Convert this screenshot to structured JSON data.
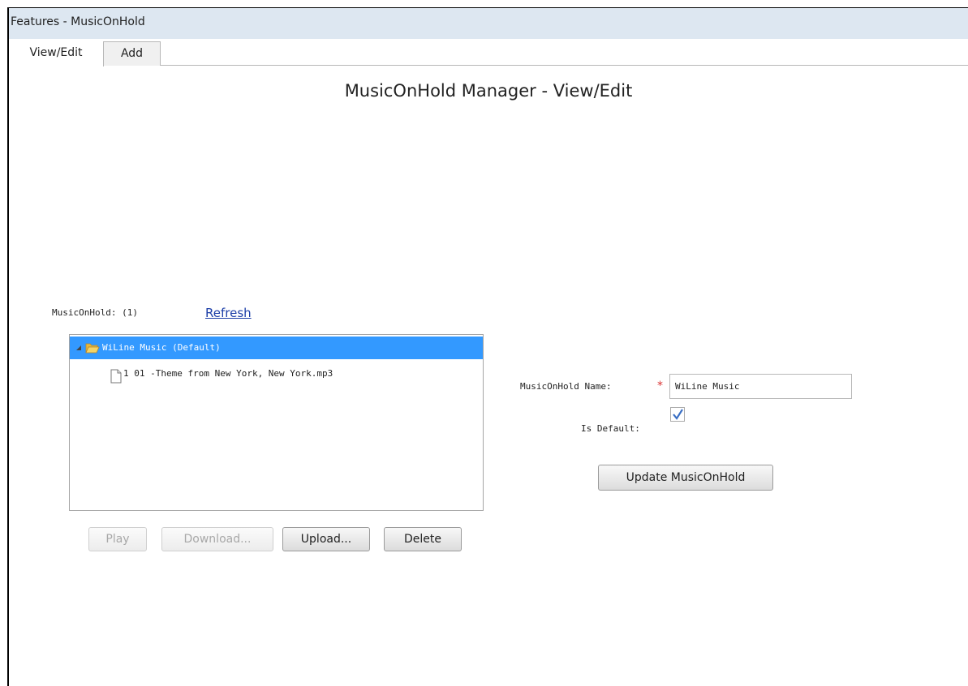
{
  "window": {
    "title": "Features - MusicOnHold"
  },
  "tabs": [
    {
      "label": "View/Edit",
      "active": true
    },
    {
      "label": "Add",
      "active": false
    }
  ],
  "page": {
    "title": "MusicOnHold Manager - View/Edit"
  },
  "list": {
    "count_label": "MusicOnHold: (1)",
    "refresh_label": "Refresh",
    "items": [
      {
        "label": "WiLine Music (Default)",
        "selected": true,
        "icon": "folder-open-icon",
        "children": [
          {
            "label": "1 01 -Theme from New York, New York.mp3",
            "icon": "file-icon"
          }
        ]
      }
    ]
  },
  "actions": {
    "play_label": "Play",
    "download_label": "Download...",
    "upload_label": "Upload...",
    "delete_label": "Delete"
  },
  "form": {
    "name_label": "MusicOnHold Name:",
    "required_marker": "*",
    "name_value": "WiLine Music",
    "default_label": "Is Default:",
    "default_checked": true,
    "update_label": "Update MusicOnHold"
  },
  "colors": {
    "titlebar": "#dde7f1",
    "selection": "#3399ff",
    "link": "#1d3fa8",
    "required": "#d93434"
  }
}
